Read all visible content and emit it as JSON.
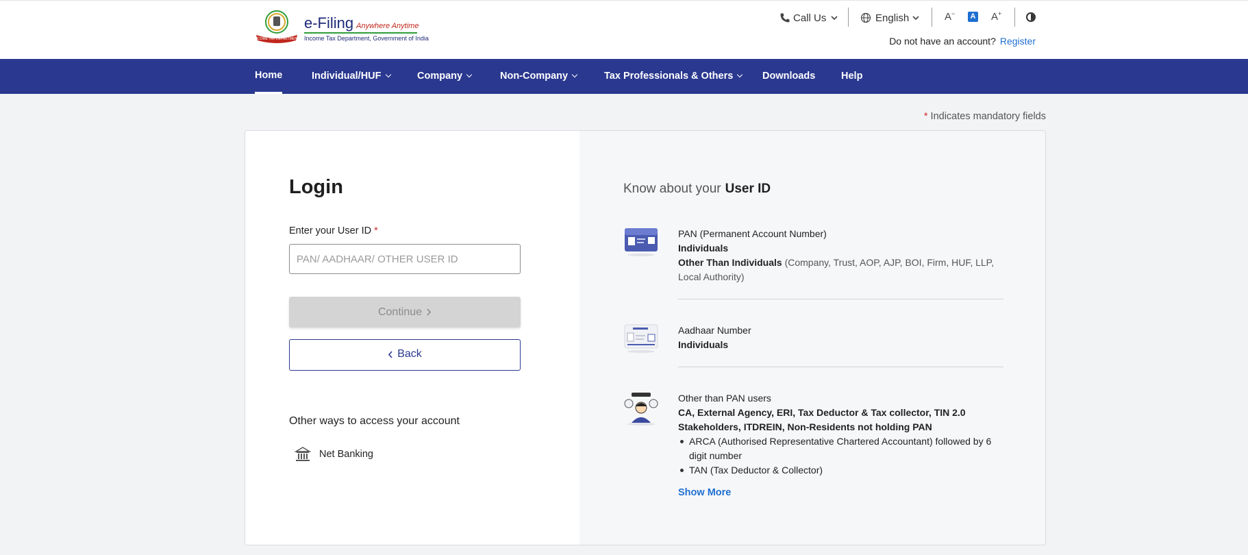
{
  "header": {
    "logo_title": "e-Filing",
    "logo_tagline": "Anywhere Anytime",
    "logo_subtitle": "Income Tax Department, Government of India",
    "call_us": "Call Us",
    "language": "English",
    "account_prompt": "Do not have an account?",
    "register": "Register"
  },
  "nav": {
    "items": [
      {
        "label": "Home",
        "active": true,
        "dropdown": false
      },
      {
        "label": "Individual/HUF",
        "dropdown": true
      },
      {
        "label": "Company",
        "dropdown": true
      },
      {
        "label": "Non-Company",
        "dropdown": true
      },
      {
        "label": "Tax Professionals & Others",
        "dropdown": true
      },
      {
        "label": "Downloads",
        "dropdown": false
      },
      {
        "label": "Help",
        "dropdown": false
      }
    ]
  },
  "mandatory_note": {
    "star": "*",
    "text": "Indicates mandatory fields"
  },
  "login": {
    "title": "Login",
    "user_id_label": "Enter your User ID",
    "required_star": "*",
    "user_id_placeholder": "PAN/ AADHAAR/ OTHER USER ID",
    "user_id_value": "",
    "continue_label": "Continue",
    "back_label": "Back",
    "other_ways": "Other ways to access your account",
    "net_banking": "Net Banking"
  },
  "know": {
    "prefix": "Know about your",
    "highlight": "User ID",
    "pan": {
      "title": "PAN (Permanent Account Number)",
      "line1": "Individuals",
      "line2_bold": "Other Than Individuals",
      "line2_rest": "(Company, Trust, AOP, AJP, BOI, Firm, HUF, LLP, Local Authority)"
    },
    "aadhaar": {
      "title": "Aadhaar Number",
      "line1": "Individuals"
    },
    "other": {
      "title": "Other than PAN users",
      "bold": "CA, External Agency, ERI, Tax Deductor & Tax collector, TIN 2.0 Stakeholders, ITDREIN, Non-Residents not holding PAN",
      "bullets": [
        "ARCA (Authorised Representative Chartered Accountant) followed by 6 digit number",
        "TAN (Tax Deductor & Collector)"
      ]
    },
    "show_more": "Show More"
  },
  "colors": {
    "nav_bg": "#2a388f",
    "link": "#1f6fd1",
    "required": "#d32f2f",
    "disabled_button": "#d4d4d4"
  }
}
